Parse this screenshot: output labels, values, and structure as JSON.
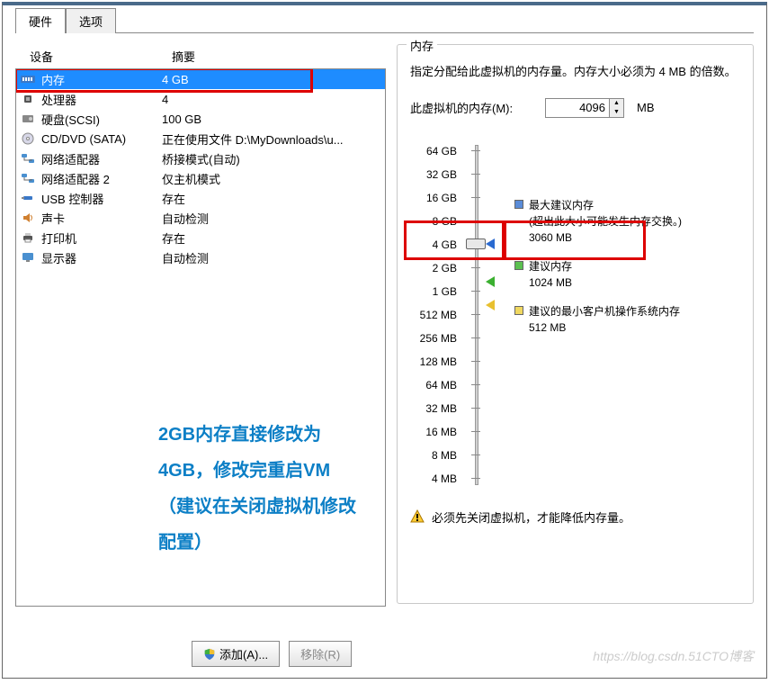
{
  "tabs": {
    "hardware": "硬件",
    "options": "选项"
  },
  "columns": {
    "device": "设备",
    "summary": "摘要"
  },
  "devices": [
    {
      "icon": "memory-icon",
      "name": "内存",
      "summary": "4 GB",
      "selected": true
    },
    {
      "icon": "cpu-icon",
      "name": "处理器",
      "summary": "4"
    },
    {
      "icon": "disk-icon",
      "name": "硬盘(SCSI)",
      "summary": "100 GB"
    },
    {
      "icon": "cd-icon",
      "name": "CD/DVD (SATA)",
      "summary": "正在使用文件 D:\\MyDownloads\\u..."
    },
    {
      "icon": "net-icon",
      "name": "网络适配器",
      "summary": "桥接模式(自动)"
    },
    {
      "icon": "net-icon",
      "name": "网络适配器 2",
      "summary": "仅主机模式"
    },
    {
      "icon": "usb-icon",
      "name": "USB 控制器",
      "summary": "存在"
    },
    {
      "icon": "sound-icon",
      "name": "声卡",
      "summary": "自动检测"
    },
    {
      "icon": "printer-icon",
      "name": "打印机",
      "summary": "存在"
    },
    {
      "icon": "display-icon",
      "name": "显示器",
      "summary": "自动检测"
    }
  ],
  "annotation_text": "2GB内存直接修改为4GB，修改完重启VM（建议在关闭虚拟机修改配置）",
  "memory_panel": {
    "title": "内存",
    "desc": "指定分配给此虚拟机的内存量。内存大小必须为 4 MB 的倍数。",
    "input_label": "此虚拟机的内存(M):",
    "value": "4096",
    "unit": "MB",
    "scale": [
      "64 GB",
      "32 GB",
      "16 GB",
      "8 GB",
      "4 GB",
      "2 GB",
      "1 GB",
      "512 MB",
      "256 MB",
      "128 MB",
      "64 MB",
      "32 MB",
      "16 MB",
      "8 MB",
      "4 MB"
    ],
    "legend": {
      "max": {
        "title": "最大建议内存",
        "note": "(超出此大小可能发生内存交换。)",
        "value": "3060 MB"
      },
      "rec": {
        "title": "建议内存",
        "value": "1024 MB"
      },
      "min": {
        "title": "建议的最小客户机操作系统内存",
        "value": "512 MB"
      }
    },
    "warning": "必须先关闭虚拟机，才能降低内存量。"
  },
  "buttons": {
    "add": "添加(A)...",
    "remove": "移除(R)"
  },
  "watermark": "https://blog.csdn.51CTO博客"
}
